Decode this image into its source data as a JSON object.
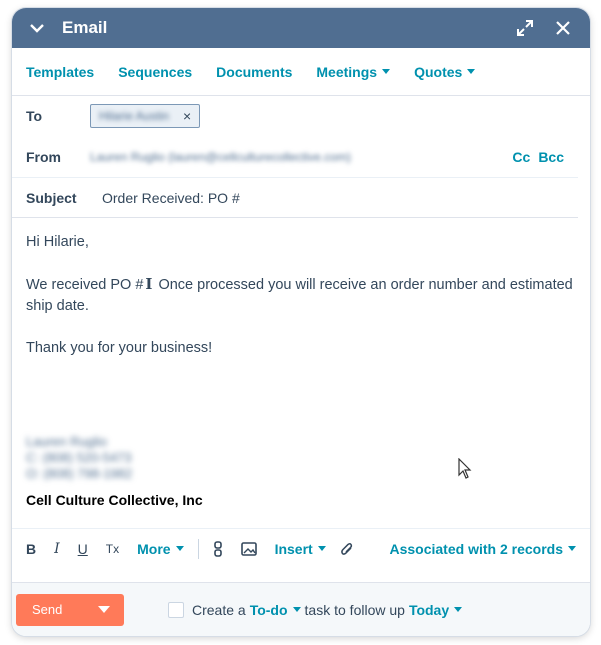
{
  "header": {
    "title": "Email"
  },
  "toolbar": {
    "templates": "Templates",
    "sequences": "Sequences",
    "documents": "Documents",
    "meetings": "Meetings",
    "quotes": "Quotes"
  },
  "to": {
    "label": "To",
    "recipient": "Hilarie Austin",
    "remove": "×"
  },
  "from": {
    "label": "From",
    "value": "Lauren Ruglio (lauren@cellculturecollective.com)",
    "cc": "Cc",
    "bcc": "Bcc"
  },
  "subject": {
    "label": "Subject",
    "value": "Order Received: PO #"
  },
  "body": {
    "greeting": "Hi Hilarie,",
    "line1_a": "We received PO #",
    "line1_b": " Once processed you will receive an order number and estimated ship date.",
    "thanks": "Thank you for your business!",
    "sig_name": "Lauren Ruglio",
    "sig_phone1": "C: (808) 520-5473",
    "sig_phone2": "O: (808) 798-1982",
    "company": "Cell Culture Collective, Inc"
  },
  "formatting": {
    "bold": "B",
    "italic": "I",
    "underline": "U",
    "clear": "Tx",
    "more": "More",
    "insert": "Insert",
    "associated": "Associated with 2 records"
  },
  "footer": {
    "send": "Send",
    "create": "Create a",
    "todo": "To-do",
    "task_text": "task to follow up",
    "today": "Today"
  },
  "colors": {
    "header": "#506e91",
    "link": "#0091ae",
    "send": "#ff7a59"
  }
}
